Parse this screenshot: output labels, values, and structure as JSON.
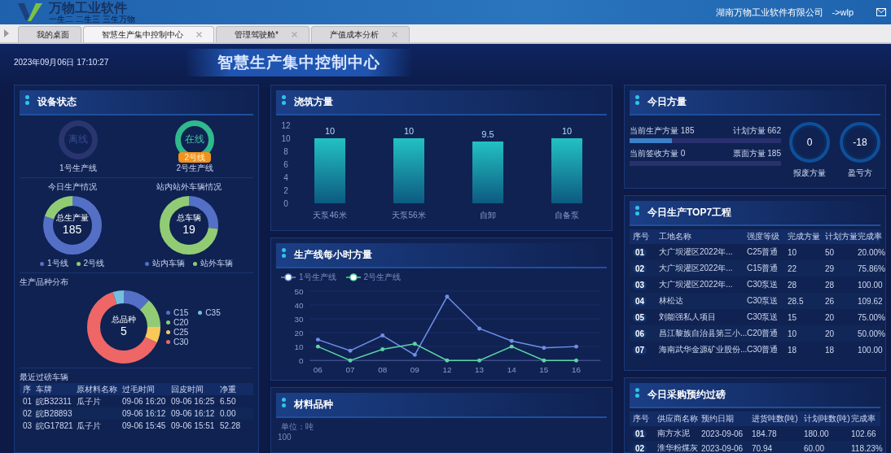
{
  "app_header": {
    "logo_text": "万物工业软件",
    "slogan": "一生二 二生三 三生万物",
    "company": "湖南万物工业软件有限公司",
    "user": "->wlp"
  },
  "tabs": [
    {
      "label": "我的桌面",
      "selected": false,
      "closable": false
    },
    {
      "label": "智慧生产集中控制中心",
      "selected": true,
      "closable": true
    },
    {
      "label": "管理驾驶舱*",
      "selected": false,
      "closable": true
    },
    {
      "label": "产值成本分析",
      "selected": false,
      "closable": true
    }
  ],
  "dashboard": {
    "datetime": "2023年09月06日 17:10:27",
    "title": "智慧生产集中控制中心"
  },
  "equipment_status": {
    "title": "设备状态",
    "lines": [
      {
        "name": "1号生产线",
        "status": "离线",
        "online": false
      },
      {
        "name": "2号生产线",
        "status": "在线",
        "online": true,
        "badge": "2号线"
      }
    ],
    "production_today": {
      "title": "今日生产情况",
      "center_label": "总生产量",
      "center_value": "185",
      "legend": [
        {
          "label": "1号线",
          "color": "#5470c6"
        },
        {
          "label": "2号线",
          "color": "#91cc75"
        }
      ]
    },
    "vehicles": {
      "title": "站内站外车辆情况",
      "center_label": "总车辆",
      "center_value": "19",
      "legend": [
        {
          "label": "站内车辆",
          "color": "#5470c6"
        },
        {
          "label": "站外车辆",
          "color": "#91cc75"
        }
      ]
    },
    "variety": {
      "title": "生产品种分布",
      "center_label": "总品种",
      "center_value": "5",
      "legend": [
        {
          "label": "C15",
          "color": "#5470c6"
        },
        {
          "label": "C35",
          "color": "#73c0de"
        },
        {
          "label": "C20",
          "color": "#91cc75"
        },
        {
          "label": "C25",
          "color": "#fac858"
        },
        {
          "label": "C30",
          "color": "#ee6666"
        }
      ]
    },
    "weighing": {
      "title": "最近过磅车辆",
      "columns": [
        "序",
        "车牌",
        "原材料名称",
        "过毛时间",
        "回皮时间",
        "净重"
      ],
      "rows": [
        [
          "01",
          "皖B32311",
          "瓜子片",
          "09-06 16:20",
          "09-06 16:25",
          "6.50"
        ],
        [
          "02",
          "皖B28893",
          "",
          "09-06 16:12",
          "09-06 16:12",
          "0.00"
        ],
        [
          "03",
          "皖G17821",
          "瓜子片",
          "09-06 15:45",
          "09-06 15:51",
          "52.28"
        ]
      ]
    }
  },
  "pour_volume": {
    "title": "浇筑方量",
    "chart_data": {
      "type": "bar",
      "categories": [
        "天泵46米",
        "天泵56米",
        "自卸",
        "自备泵"
      ],
      "values": [
        10,
        10,
        9.5,
        10
      ],
      "ylim": [
        0,
        12
      ],
      "yticks": [
        0,
        2,
        4,
        6,
        8,
        10,
        12
      ],
      "data_labels": true
    }
  },
  "hourly_volume": {
    "title": "生产线每小时方量",
    "chart_data": {
      "type": "line",
      "categories": [
        "06",
        "07",
        "08",
        "09",
        "12",
        "13",
        "14",
        "15",
        "16"
      ],
      "series": [
        {
          "name": "1号生产线",
          "color": "#6f8ee8",
          "values": [
            15,
            7,
            18,
            4,
            46,
            23,
            14,
            9,
            10
          ]
        },
        {
          "name": "2号生产线",
          "color": "#5fd3a5",
          "values": [
            10,
            0,
            8,
            12,
            0,
            0,
            10,
            0,
            0
          ]
        }
      ],
      "ylim": [
        0,
        50
      ],
      "yticks": [
        0,
        10,
        20,
        30,
        40,
        50
      ],
      "grid": true
    }
  },
  "materials": {
    "title": "材料品种",
    "unit": "单位：吨",
    "top_tick": "100"
  },
  "today_volume": {
    "title": "今日方量",
    "bars": [
      {
        "label": "当前生产方量 185",
        "target": "计划方量 662",
        "level": 0.28
      },
      {
        "label": "当前签收方量 0",
        "target": "票面方量 185",
        "level": 0
      }
    ],
    "gauges": [
      {
        "value": "0",
        "label": "报废方量"
      },
      {
        "value": "-18",
        "label": "盈亏方"
      }
    ]
  },
  "top7": {
    "title": "今日生产TOP7工程",
    "columns": [
      "序号",
      "工地名称",
      "强度等级",
      "完成方量",
      "计划方量",
      "完成率"
    ],
    "rows": [
      [
        "01",
        "大广坝灌区2022年...",
        "C25普通",
        "10",
        "50",
        "20.00%"
      ],
      [
        "02",
        "大广坝灌区2022年...",
        "C15普通",
        "22",
        "29",
        "75.86%"
      ],
      [
        "03",
        "大广坝灌区2022年...",
        "C30泵送",
        "28",
        "28",
        "100.00"
      ],
      [
        "04",
        "林松达",
        "C30泵送",
        "28.5",
        "26",
        "109.62"
      ],
      [
        "05",
        "刘能强私人项目",
        "C30泵送",
        "15",
        "20",
        "75.00%"
      ],
      [
        "06",
        "昌江黎族自治县第三小...",
        "C20普通",
        "10",
        "20",
        "50.00%"
      ],
      [
        "07",
        "海南武华金源矿业股份...",
        "C30普通",
        "18",
        "18",
        "100.00"
      ]
    ]
  },
  "purchase": {
    "title": "今日采购预约过磅",
    "columns": [
      "序号",
      "供应商名称",
      "预约日期",
      "进货吨数(吨)",
      "计划吨数(吨)",
      "完成率"
    ],
    "rows": [
      [
        "01",
        "南方水泥",
        "2023-09-06",
        "184.78",
        "180.00",
        "102.66"
      ],
      [
        "02",
        "淮华粉煤灰",
        "2023-09-06",
        "70.94",
        "60.00",
        "118.23%"
      ]
    ]
  }
}
